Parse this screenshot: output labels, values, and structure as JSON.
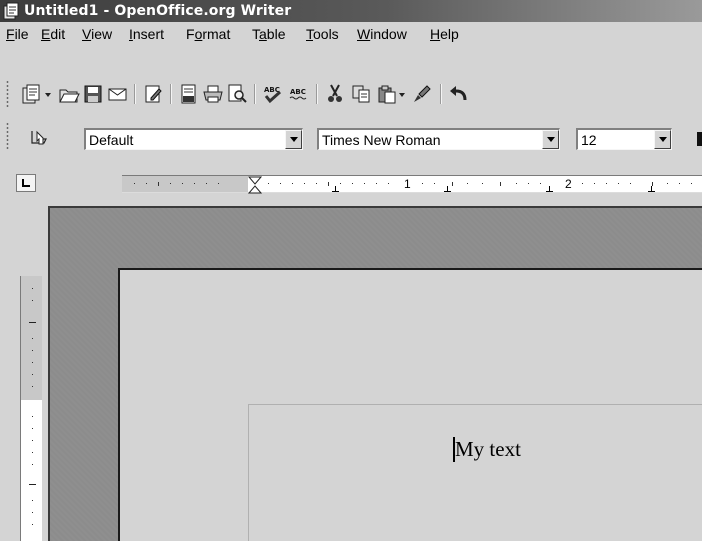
{
  "window": {
    "title": "Untitled1 - OpenOffice.org Writer",
    "icon": "writer-app-icon"
  },
  "menubar": {
    "items": [
      {
        "mnemonic": "F",
        "rest": "ile"
      },
      {
        "mnemonic": "E",
        "rest": "dit"
      },
      {
        "mnemonic": "V",
        "rest": "iew"
      },
      {
        "mnemonic": "I",
        "rest": "nsert"
      },
      {
        "pre": "F",
        "mnemonic": "o",
        "rest": "rmat"
      },
      {
        "pre": "T",
        "mnemonic": "a",
        "rest": "ble"
      },
      {
        "mnemonic": "T",
        "rest": "ools"
      },
      {
        "mnemonic": "W",
        "rest": "indow"
      },
      {
        "mnemonic": "H",
        "rest": "elp"
      }
    ]
  },
  "toolbar_standard": {
    "icons": [
      "new-document-icon",
      "open-folder-icon",
      "save-floppy-icon",
      "email-icon",
      "edit-file-icon",
      "export-pdf-icon",
      "print-icon",
      "page-preview-icon",
      "spellcheck-icon",
      "autospellcheck-icon",
      "cut-scissors-icon",
      "copy-icon",
      "paste-icon",
      "format-paintbrush-icon",
      "undo-arrow-icon"
    ]
  },
  "toolbar_formatting": {
    "styles_icon": "styles-formatting-icon",
    "paragraph_style": "Default",
    "font_name": "Times New Roman",
    "font_size": "12"
  },
  "ruler": {
    "numbers": [
      "1",
      "2"
    ]
  },
  "document": {
    "text": "My text"
  }
}
